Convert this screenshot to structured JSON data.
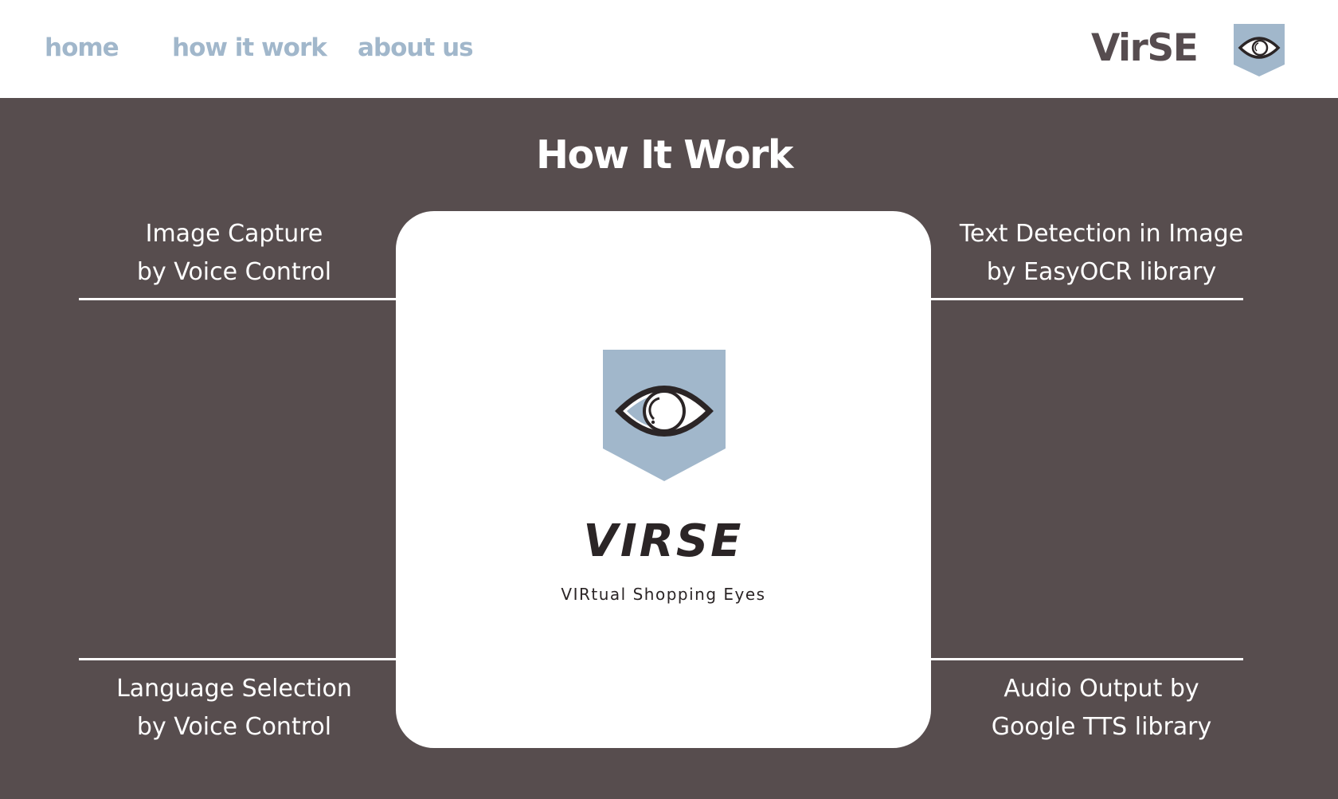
{
  "nav": {
    "links": [
      "home",
      "how it work",
      "about us"
    ]
  },
  "brand": {
    "name": "VirSE",
    "icon": "eye-icon",
    "badge_color": "#a1b7cb"
  },
  "section": {
    "title": "How It Work"
  },
  "features": {
    "top_left": [
      "Image Capture",
      "by Voice Control"
    ],
    "top_right": [
      "Text Detection in Image",
      "by EasyOCR library"
    ],
    "bottom_left": [
      "Language Selection",
      "by Voice Control"
    ],
    "bottom_right": [
      "Audio Output by",
      "Google TTS library"
    ]
  },
  "logo": {
    "wordmark": "VIRSE",
    "tagline": "VIRtual Shopping Eyes",
    "icon": "eye-icon"
  },
  "colors": {
    "background": "#574d4e",
    "accent": "#a1b7cb",
    "text_dark": "#564c4f"
  }
}
